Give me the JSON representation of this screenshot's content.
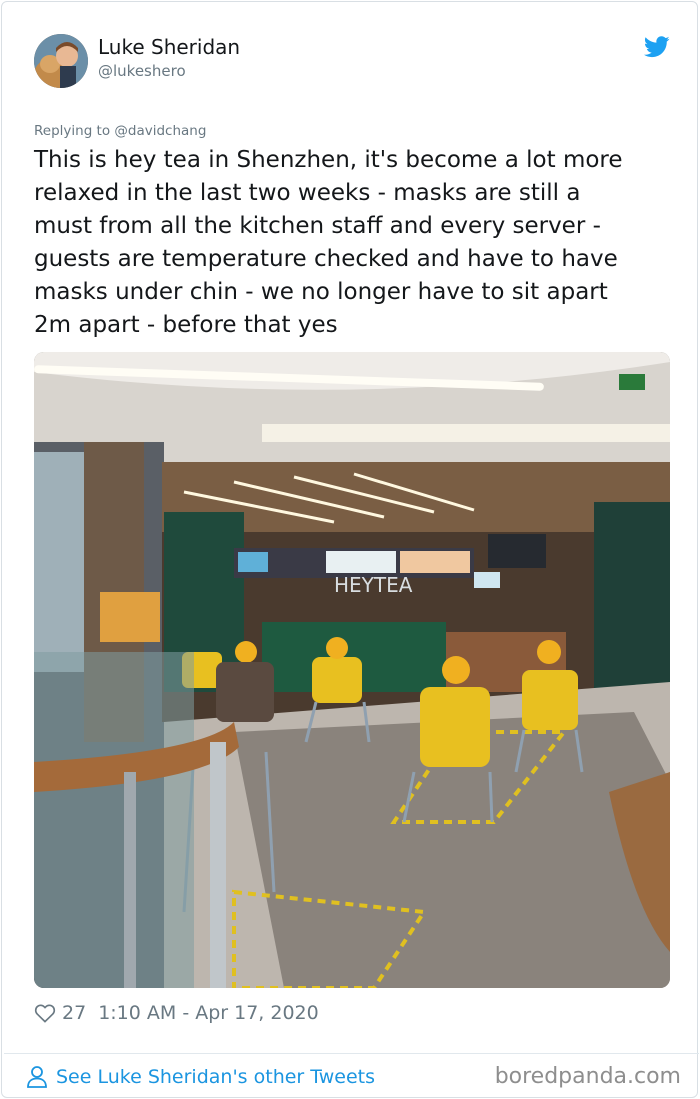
{
  "tweet": {
    "display_name": "Luke Sheridan",
    "handle": "@lukeshero",
    "reply_to": "Replying to @davidchang",
    "text_lines": [
      "This is hey tea in Shenzhen, it's become a lot more",
      "relaxed in the last two weeks - masks are still a",
      "must from all the kitchen staff and every server -",
      "guests are temperature checked and have to have",
      "masks under chin - we no longer have to sit apart",
      "2m apart - before that yes"
    ],
    "likes": "27",
    "timestamp": "1:10 AM - Apr 17, 2020",
    "photo_sign": "HEYTEA"
  },
  "footer": {
    "other_tweets": "See Luke Sheridan's other Tweets",
    "watermark": "boredpanda.com"
  },
  "icons": {
    "brand": "twitter-bird-icon",
    "like": "heart-icon",
    "profile": "person-icon"
  },
  "colors": {
    "twitter_blue": "#1da1f2",
    "link_blue": "#1b95e0",
    "secondary_text": "#697882"
  }
}
